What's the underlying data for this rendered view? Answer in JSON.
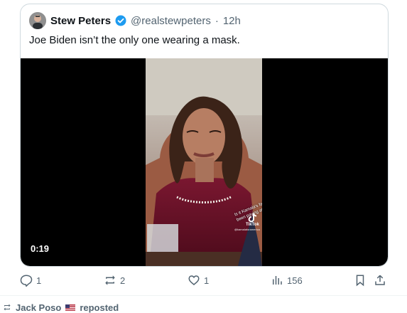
{
  "tweet": {
    "author_name": "Stew Peters",
    "handle": "@realstewpeters",
    "separator": "·",
    "time": "12h",
    "text": "Joe Biden isn’t the only one wearing a mask.",
    "media": {
      "duration": "0:19",
      "caption": "Is it Kamala's fault if you haven't been paying attention?!",
      "watermark_label": "TikTok",
      "watermark_handle": "@kamalaforamerica",
      "icon": "tiktok-icon"
    }
  },
  "actions": {
    "reply_count": "1",
    "repost_count": "2",
    "like_count": "1",
    "view_count": "156"
  },
  "next_item": {
    "reposter": "Jack Poso",
    "suffix": "reposted"
  },
  "colors": {
    "verified": "#1d9bf0",
    "muted": "#536471",
    "border": "#cfd9de"
  }
}
